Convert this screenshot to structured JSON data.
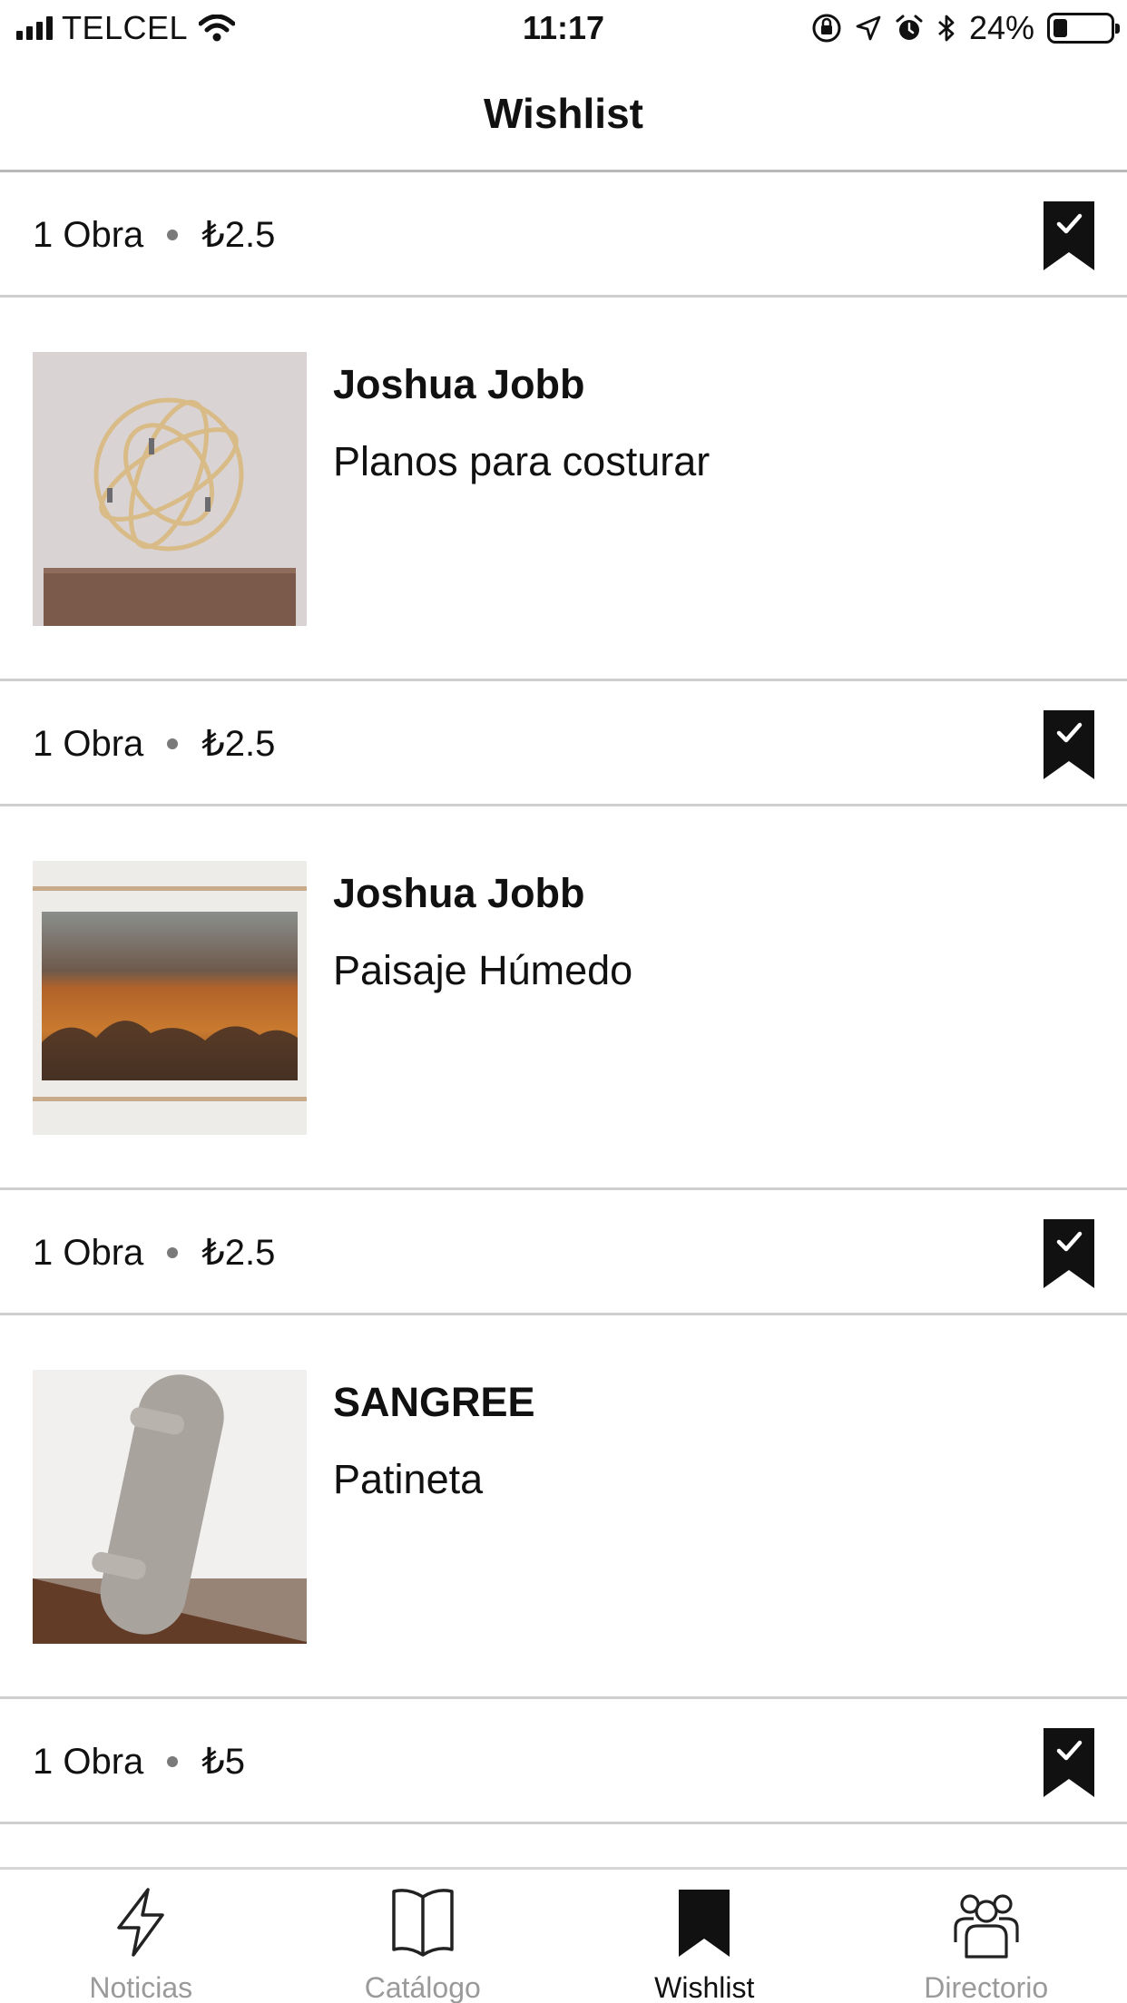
{
  "status_bar": {
    "carrier": "TELCEL",
    "time": "11:17",
    "battery_percent": "24%",
    "battery_level": 0.24,
    "icons": [
      "signal-icon",
      "wifi-icon",
      "orientation-lock-icon",
      "location-icon",
      "alarm-icon",
      "bluetooth-icon",
      "battery-icon"
    ]
  },
  "header": {
    "title": "Wishlist"
  },
  "groups": [
    {
      "count": "1 Obra",
      "price": "₺2.5",
      "artist": "Joshua Jobb",
      "title": "Planos para costurar",
      "bookmarked": true
    },
    {
      "count": "1 Obra",
      "price": "₺2.5",
      "artist": "Joshua Jobb",
      "title": "Paisaje Húmedo",
      "bookmarked": true
    },
    {
      "count": "1 Obra",
      "price": "₺2.5",
      "artist": "SANGREE",
      "title": "Patineta",
      "bookmarked": true
    },
    {
      "count": "1 Obra",
      "price": "₺5",
      "bookmarked": true
    }
  ],
  "tab_bar": {
    "tabs": [
      {
        "label": "Noticias",
        "icon": "lightning-icon",
        "active": false
      },
      {
        "label": "Catálogo",
        "icon": "book-icon",
        "active": false
      },
      {
        "label": "Wishlist",
        "icon": "bookmark-icon",
        "active": true
      },
      {
        "label": "Directorio",
        "icon": "people-icon",
        "active": false
      }
    ]
  },
  "colors": {
    "accent": "#111111",
    "inactive_tab": "#9a9a9a",
    "divider": "#cfcfcf"
  }
}
